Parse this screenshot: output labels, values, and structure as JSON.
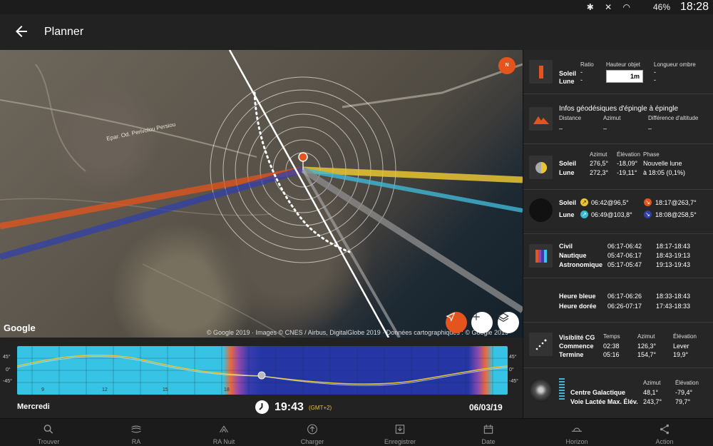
{
  "status_bar": {
    "battery": "46%",
    "clock": "18:28",
    "icons": [
      "bluetooth-icon",
      "mute-icon",
      "wifi-icon",
      "battery-icon"
    ]
  },
  "appbar": {
    "title": "Planner"
  },
  "map": {
    "google_logo": "Google",
    "attribution": "© Google 2019 · Images © CNES / Airbus, DigitalGlobe 2019 · Données cartographiques : © Google 2019",
    "compass_label": "N",
    "road_label": "Epar. Od. Perivolou Persiou"
  },
  "timeline": {
    "y_labels": [
      "45°",
      "0°",
      "-45°"
    ],
    "x_labels": [
      "9",
      "12",
      "15",
      "18"
    ],
    "day": "Mercredi",
    "time": "19:43",
    "gmt": "(GMT+2)",
    "date": "06/03/19"
  },
  "panel": {
    "shadow": {
      "col_ratio": "Ratio",
      "col_height": "Hauteur objet",
      "col_length": "Longueur ombre",
      "sun": "Soleil",
      "moon": "Lune",
      "ratio_sun": "-",
      "ratio_moon": "-",
      "height_value": "1m",
      "length_sun": "-",
      "length_moon": "-"
    },
    "geodesic": {
      "title": "Infos géodésiques d'épingle à épingle",
      "col_distance": "Distance",
      "col_azimuth": "Azimut",
      "col_altdiff": "Différence d'altitude",
      "distance": "–",
      "azimuth": "–",
      "altdiff": "–"
    },
    "position": {
      "col_azimuth": "Azimut",
      "col_elevation": "Élévation",
      "col_phase": "Phase",
      "sun": "Soleil",
      "moon": "Lune",
      "sun_az": "276,5°",
      "sun_el": "-18,09°",
      "moon_az": "272,3°",
      "moon_el": "-19,11°",
      "phase_line1": "Nouvelle lune",
      "phase_line2": "à 18:05 (0,1%)"
    },
    "rise_set": {
      "sun": "Soleil",
      "moon": "Lune",
      "sun_rise": "06:42@96,5°",
      "sun_set": "18:17@263,7°",
      "moon_rise": "06:49@103,8°",
      "moon_set": "18:08@258,5°"
    },
    "twilight": {
      "civil": "Civil",
      "nautical": "Nautique",
      "astronomical": "Astronomique",
      "civil_am": "06:17-06:42",
      "civil_pm": "18:17-18:43",
      "nautical_am": "05:47-06:17",
      "nautical_pm": "18:43-19:13",
      "astro_am": "05:17-05:47",
      "astro_pm": "19:13-19:43"
    },
    "hours": {
      "blue": "Heure bleue",
      "golden": "Heure dorée",
      "blue_am": "06:17-06:26",
      "blue_pm": "18:33-18:43",
      "golden_am": "06:26-07:17",
      "golden_pm": "17:43-18:33"
    },
    "iss": {
      "title": "Visiblité CG",
      "start": "Commence",
      "end": "Termine",
      "col_time": "Temps",
      "col_azimuth": "Azimut",
      "col_elevation": "Élévation",
      "start_time": "02:38",
      "start_az": "126,3°",
      "start_el": "Lever",
      "end_time": "05:16",
      "end_az": "154,7°",
      "end_el": "19,9°"
    },
    "milkyway": {
      "col_azimuth": "Azimut",
      "col_elevation": "Élévation",
      "center": "Centre Galactique",
      "max": "Voie Lactée Max. Élév.",
      "center_az": "48,1°",
      "center_el": "-79,4°",
      "max_az": "243,7°",
      "max_el": "79,7°"
    }
  },
  "nav": {
    "items": [
      {
        "label": "Trouver",
        "icon": "search-icon"
      },
      {
        "label": "RA",
        "icon": "ar-icon"
      },
      {
        "label": "RA Nuit",
        "icon": "ar-night-icon"
      },
      {
        "label": "Charger",
        "icon": "upload-icon"
      },
      {
        "label": "Enregistrer",
        "icon": "save-icon"
      },
      {
        "label": "Date",
        "icon": "calendar-icon"
      },
      {
        "label": "Horizon",
        "icon": "horizon-icon"
      },
      {
        "label": "Action",
        "icon": "share-icon"
      }
    ]
  },
  "colors": {
    "accent": "#e4541c",
    "sun_line": "#e8c531",
    "moon_line": "#3fb7d4",
    "day_sky": "#37c3e3",
    "night_sky": "#2536a4"
  }
}
